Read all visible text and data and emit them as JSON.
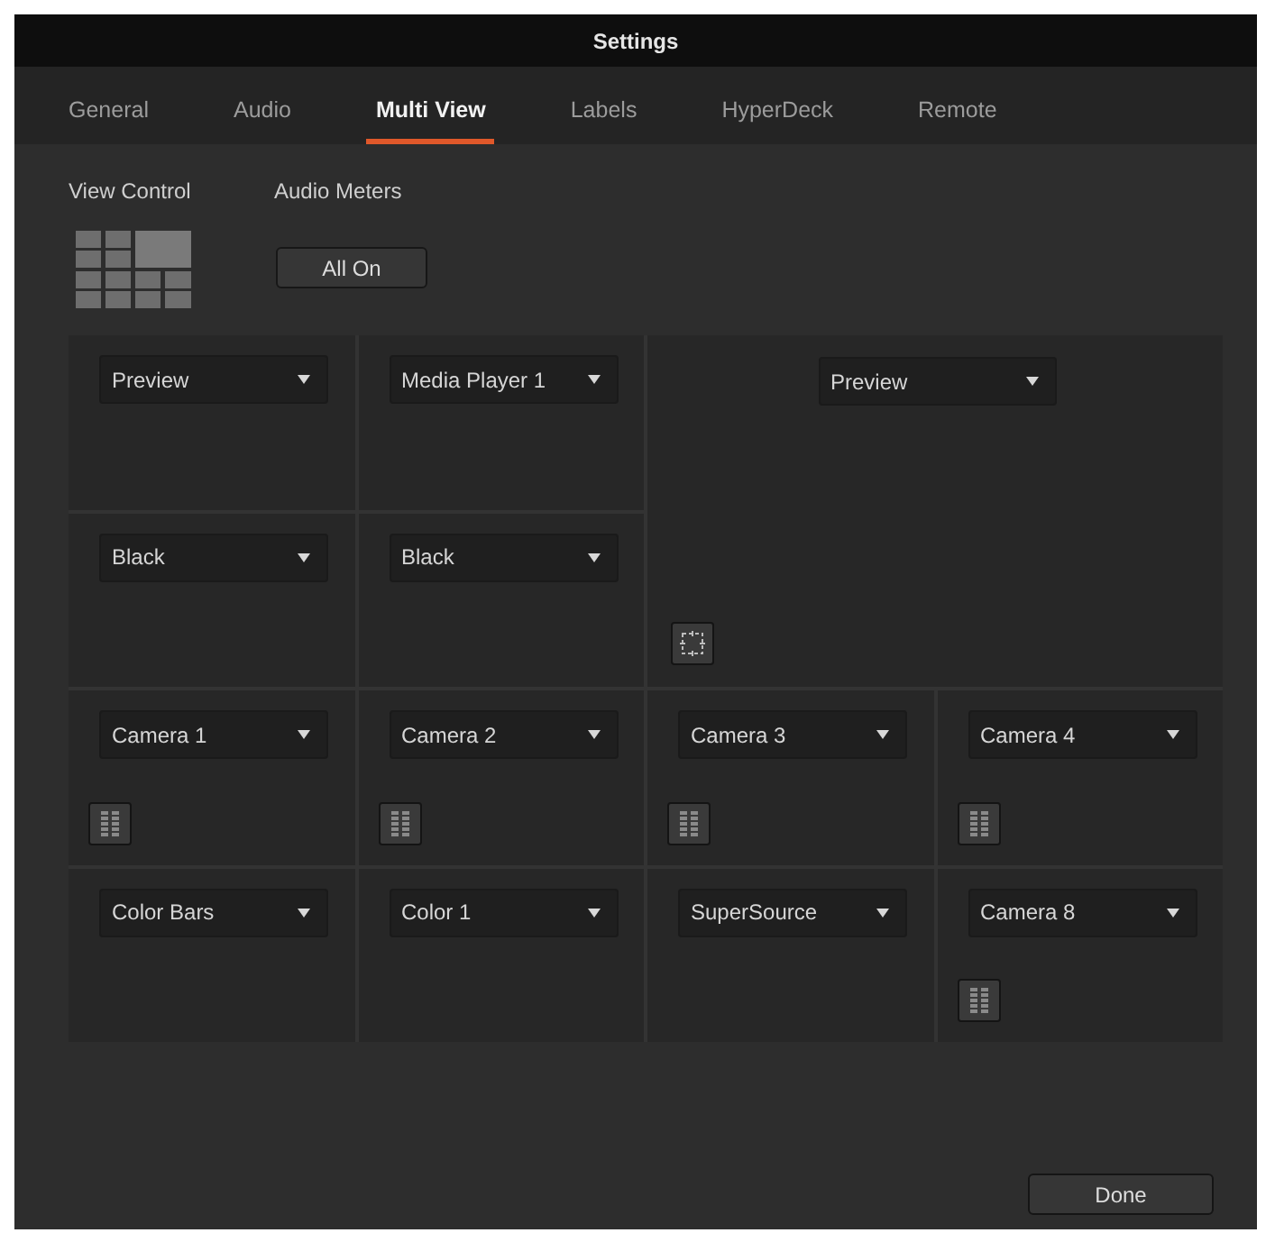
{
  "window": {
    "title": "Settings"
  },
  "tabs": [
    {
      "label": "General",
      "selected": false
    },
    {
      "label": "Audio",
      "selected": false
    },
    {
      "label": "Multi View",
      "selected": true
    },
    {
      "label": "Labels",
      "selected": false
    },
    {
      "label": "HyperDeck",
      "selected": false
    },
    {
      "label": "Remote",
      "selected": false
    }
  ],
  "view_control": {
    "label": "View Control"
  },
  "audio_meters": {
    "label": "Audio Meters",
    "button": "All On"
  },
  "multiview_windows": [
    {
      "kind": "plain",
      "source": "Preview"
    },
    {
      "kind": "plain",
      "source": "Media Player 1"
    },
    {
      "kind": "large",
      "source": "Preview"
    },
    {
      "kind": "plain",
      "source": "Black"
    },
    {
      "kind": "plain",
      "source": "Black"
    },
    {
      "kind": "metered",
      "source": "Camera 1"
    },
    {
      "kind": "metered",
      "source": "Camera 2"
    },
    {
      "kind": "metered",
      "source": "Camera 3"
    },
    {
      "kind": "metered",
      "source": "Camera 4"
    },
    {
      "kind": "plain",
      "source": "Color Bars"
    },
    {
      "kind": "plain",
      "source": "Color 1"
    },
    {
      "kind": "plain",
      "source": "SuperSource"
    },
    {
      "kind": "metered",
      "source": "Camera 8"
    }
  ],
  "buttons": [
    {
      "label": "Done"
    }
  ]
}
